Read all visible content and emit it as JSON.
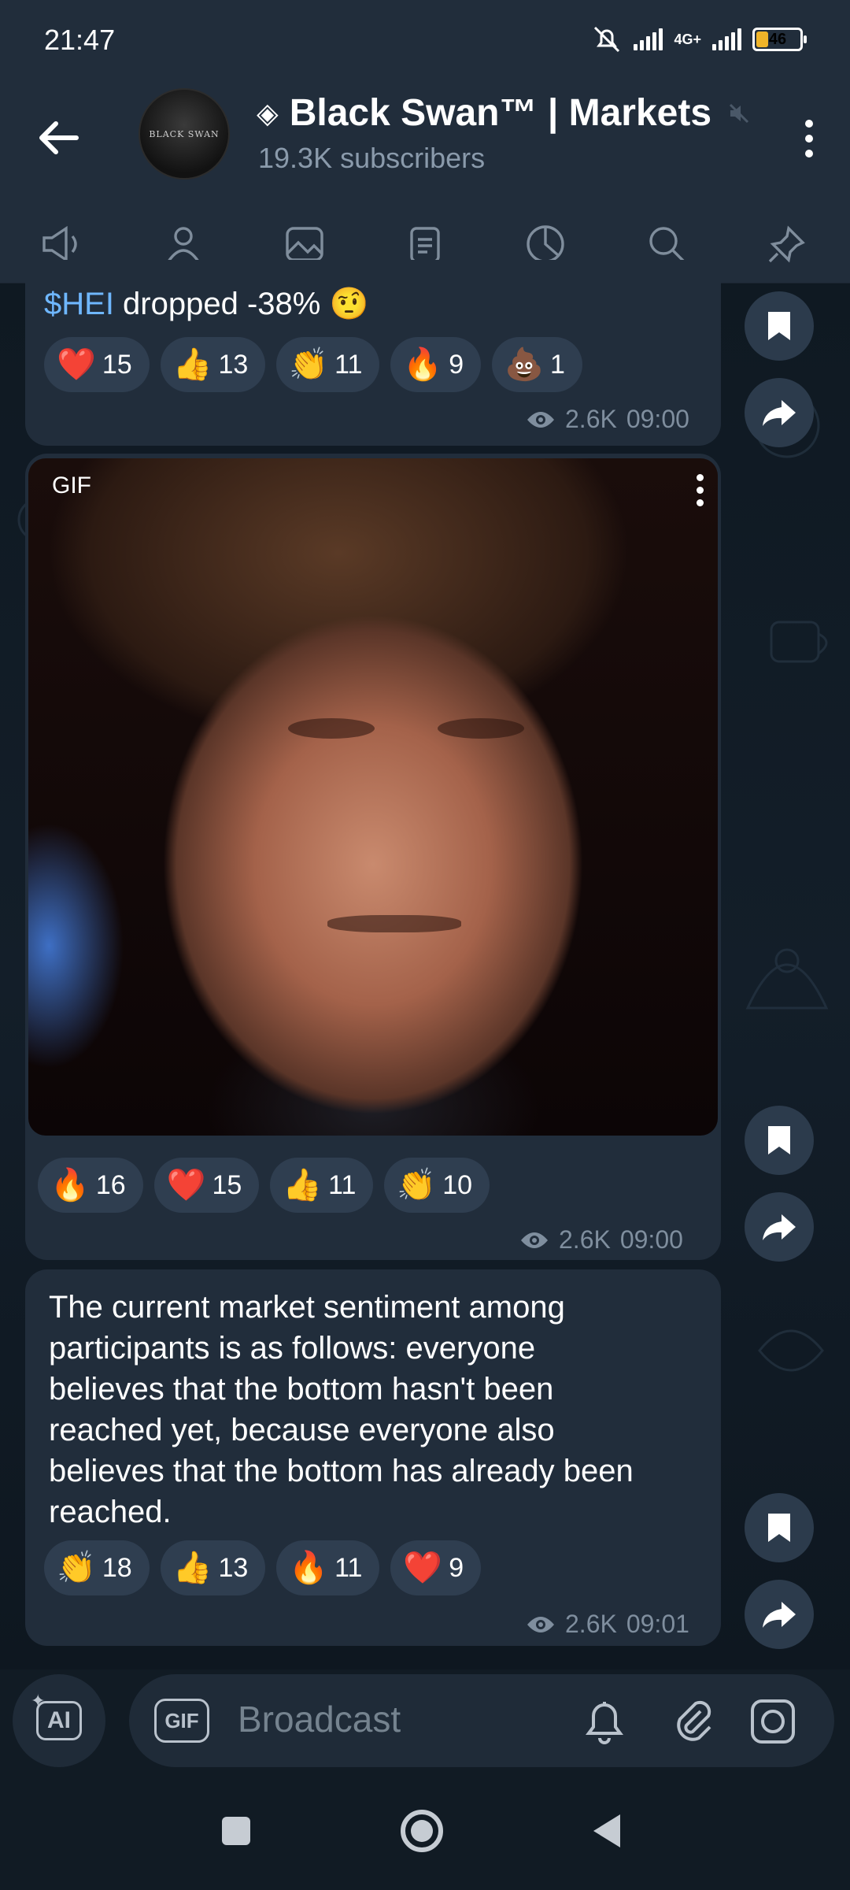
{
  "status": {
    "time": "21:47",
    "network": "4G+",
    "battery": "46"
  },
  "header": {
    "title": "Black Swan™ | Markets",
    "subscribers": "19.3K subscribers",
    "avatar_text": "BLACK SWAN"
  },
  "tabs": [
    "megaphone-icon",
    "person-icon",
    "image-icon",
    "clipboard-icon",
    "pie-chart-icon",
    "search-icon",
    "pin-icon"
  ],
  "messages": [
    {
      "ticker": "$HEI",
      "text": " dropped -38% 🤨",
      "reactions": [
        {
          "emoji": "❤️",
          "count": "15"
        },
        {
          "emoji": "👍",
          "count": "13"
        },
        {
          "emoji": "👏",
          "count": "11"
        },
        {
          "emoji": "🔥",
          "count": "9"
        },
        {
          "emoji": "💩",
          "count": "1"
        }
      ],
      "views": "2.6K",
      "time": "09:00"
    },
    {
      "media_label": "GIF",
      "reactions": [
        {
          "emoji": "🔥",
          "count": "16"
        },
        {
          "emoji": "❤️",
          "count": "15"
        },
        {
          "emoji": "👍",
          "count": "11"
        },
        {
          "emoji": "👏",
          "count": "10"
        }
      ],
      "views": "2.6K",
      "time": "09:00"
    },
    {
      "text_lines": [
        "The current market sentiment among",
        "participants is as follows: everyone",
        "believes that the bottom hasn't been",
        "reached yet, because everyone also",
        "believes that the bottom has already been",
        "reached."
      ],
      "reactions": [
        {
          "emoji": "👏",
          "count": "18"
        },
        {
          "emoji": "👍",
          "count": "13"
        },
        {
          "emoji": "🔥",
          "count": "11"
        },
        {
          "emoji": "❤️",
          "count": "9"
        }
      ],
      "views": "2.6K",
      "time": "09:01"
    }
  ],
  "input": {
    "placeholder": "Broadcast",
    "gif_label": "GIF",
    "ai_label": "AI"
  },
  "colors": {
    "accent": "#6fb7ff",
    "bubble": "#212d3b",
    "reaction_bg": "#2f3e50",
    "battery": "#f0b429"
  }
}
